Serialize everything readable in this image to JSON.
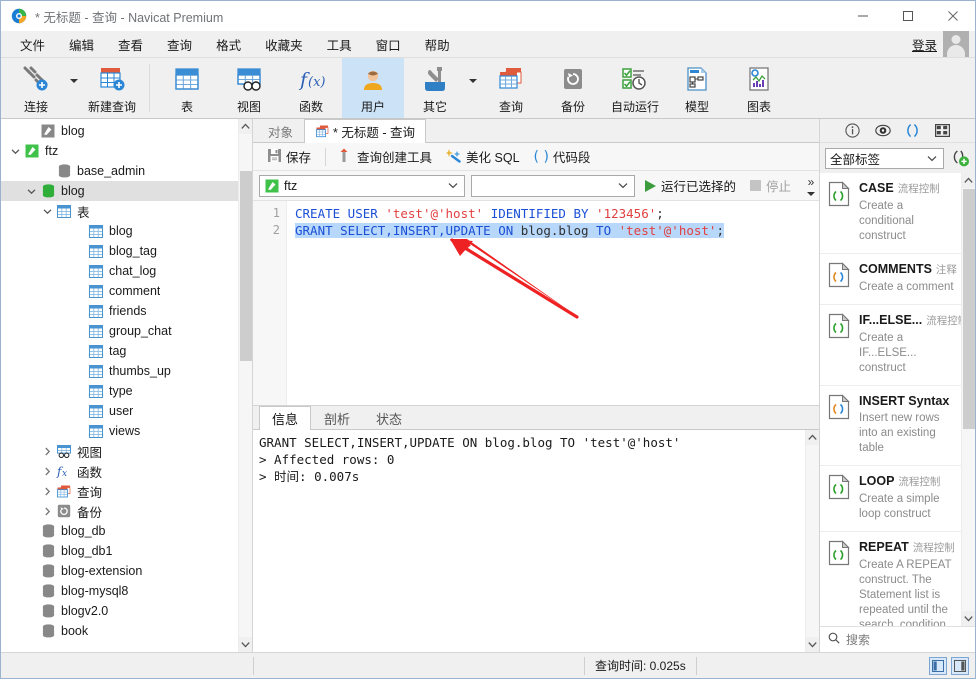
{
  "window": {
    "title_prefix": "*",
    "title": "无标题 - 查询 - Navicat Premium",
    "minimize": "–",
    "maximize": "□",
    "close": "×"
  },
  "menubar": {
    "items": [
      {
        "label": "文件"
      },
      {
        "label": "编辑"
      },
      {
        "label": "查看"
      },
      {
        "label": "查询"
      },
      {
        "label": "格式"
      },
      {
        "label": "收藏夹"
      },
      {
        "label": "工具"
      },
      {
        "label": "窗口"
      },
      {
        "label": "帮助"
      }
    ],
    "login_label": "登录"
  },
  "ribbon": {
    "items": [
      {
        "label": "连接",
        "icon": "connection-icon",
        "has_caret": true,
        "active": false
      },
      {
        "label": "新建查询",
        "icon": "new-query-icon",
        "has_caret": false,
        "active": false
      },
      {
        "label": "表",
        "icon": "table-icon",
        "active": false
      },
      {
        "label": "视图",
        "icon": "view-icon",
        "active": false
      },
      {
        "label": "函数",
        "icon": "function-icon",
        "active": false
      },
      {
        "label": "用户",
        "icon": "user-icon",
        "active": true
      },
      {
        "label": "其它",
        "icon": "other-icon",
        "has_caret": true,
        "active": false
      },
      {
        "label": "查询",
        "icon": "query-icon",
        "active": false
      },
      {
        "label": "备份",
        "icon": "backup-icon",
        "active": false
      },
      {
        "label": "自动运行",
        "icon": "automation-icon",
        "active": false
      },
      {
        "label": "模型",
        "icon": "model-icon",
        "active": false
      },
      {
        "label": "图表",
        "icon": "chart-icon",
        "active": false
      }
    ]
  },
  "sidebar": {
    "items": [
      {
        "label": "blog",
        "indent": 1,
        "icon": "connection-grey-icon",
        "twist": "none",
        "selected": false
      },
      {
        "label": "ftz",
        "indent": 0,
        "icon": "connection-green-icon",
        "twist": "open",
        "selected": false
      },
      {
        "label": "base_admin",
        "indent": 2,
        "icon": "db-grey-icon",
        "twist": "none",
        "selected": false
      },
      {
        "label": "blog",
        "indent": 1,
        "icon": "db-green-icon",
        "twist": "open",
        "selected": true
      },
      {
        "label": "表",
        "indent": 2,
        "icon": "tables-icon",
        "twist": "open",
        "selected": false
      },
      {
        "label": "blog",
        "indent": 4,
        "icon": "table-blue-icon",
        "twist": "none",
        "selected": false
      },
      {
        "label": "blog_tag",
        "indent": 4,
        "icon": "table-blue-icon",
        "twist": "none",
        "selected": false
      },
      {
        "label": "chat_log",
        "indent": 4,
        "icon": "table-blue-icon",
        "twist": "none",
        "selected": false
      },
      {
        "label": "comment",
        "indent": 4,
        "icon": "table-blue-icon",
        "twist": "none",
        "selected": false
      },
      {
        "label": "friends",
        "indent": 4,
        "icon": "table-blue-icon",
        "twist": "none",
        "selected": false
      },
      {
        "label": "group_chat",
        "indent": 4,
        "icon": "table-blue-icon",
        "twist": "none",
        "selected": false
      },
      {
        "label": "tag",
        "indent": 4,
        "icon": "table-blue-icon",
        "twist": "none",
        "selected": false
      },
      {
        "label": "thumbs_up",
        "indent": 4,
        "icon": "table-blue-icon",
        "twist": "none",
        "selected": false
      },
      {
        "label": "type",
        "indent": 4,
        "icon": "table-blue-icon",
        "twist": "none",
        "selected": false
      },
      {
        "label": "user",
        "indent": 4,
        "icon": "table-blue-icon",
        "twist": "none",
        "selected": false
      },
      {
        "label": "views",
        "indent": 4,
        "icon": "table-blue-icon",
        "twist": "none",
        "selected": false
      },
      {
        "label": "视图",
        "indent": 2,
        "icon": "views-icon",
        "twist": "closed",
        "selected": false
      },
      {
        "label": "函数",
        "indent": 2,
        "icon": "functions-icon",
        "twist": "closed",
        "selected": false
      },
      {
        "label": "查询",
        "indent": 2,
        "icon": "queries-icon",
        "twist": "closed",
        "selected": false
      },
      {
        "label": "备份",
        "indent": 2,
        "icon": "backups-icon",
        "twist": "closed",
        "selected": false
      },
      {
        "label": "blog_db",
        "indent": 1,
        "icon": "db-grey-icon",
        "twist": "none",
        "selected": false
      },
      {
        "label": "blog_db1",
        "indent": 1,
        "icon": "db-grey-icon",
        "twist": "none",
        "selected": false
      },
      {
        "label": "blog-extension",
        "indent": 1,
        "icon": "db-grey-icon",
        "twist": "none",
        "selected": false
      },
      {
        "label": "blog-mysql8",
        "indent": 1,
        "icon": "db-grey-icon",
        "twist": "none",
        "selected": false
      },
      {
        "label": "blogv2.0",
        "indent": 1,
        "icon": "db-grey-icon",
        "twist": "none",
        "selected": false
      },
      {
        "label": "book",
        "indent": 1,
        "icon": "db-grey-icon",
        "twist": "none",
        "selected": false
      }
    ]
  },
  "editor_tabs": [
    {
      "label": "对象",
      "active": false,
      "icon": "none"
    },
    {
      "label": "* 无标题 - 查询",
      "active": true,
      "icon": "query-tab-icon"
    }
  ],
  "query_toolbar": {
    "save": "保存",
    "query_builder": "查询创建工具",
    "beautify_sql": "美化 SQL",
    "code_snippet": "代码段"
  },
  "query_bar": {
    "connection_value": "ftz",
    "database_value": "",
    "run_selected": "运行已选择的",
    "stop": "停止",
    "overflow": "»"
  },
  "sql": {
    "lines": [
      {
        "number": "1",
        "selected": false,
        "tokens": [
          {
            "t": "CREATE USER ",
            "c": "kw"
          },
          {
            "t": "'test'@'host'",
            "c": "str"
          },
          {
            "t": " ",
            "c": "pl"
          },
          {
            "t": "IDENTIFIED BY ",
            "c": "kw"
          },
          {
            "t": "'123456'",
            "c": "str"
          },
          {
            "t": ";",
            "c": "pl"
          }
        ]
      },
      {
        "number": "2",
        "selected": true,
        "tokens": [
          {
            "t": "GRANT SELECT,INSERT,UPDATE ON ",
            "c": "kw"
          },
          {
            "t": "blog.blog",
            "c": "pl"
          },
          {
            "t": " ",
            "c": "pl"
          },
          {
            "t": "TO ",
            "c": "kw"
          },
          {
            "t": "'test'@'host'",
            "c": "str"
          },
          {
            "t": ";",
            "c": "pl"
          }
        ]
      }
    ]
  },
  "result_tabs": [
    {
      "label": "信息",
      "active": true
    },
    {
      "label": "剖析",
      "active": false
    },
    {
      "label": "状态",
      "active": false
    }
  ],
  "result_output": "GRANT SELECT,INSERT,UPDATE ON blog.blog TO 'test'@'host'\n> Affected rows: 0\n> 时间: 0.007s",
  "right_panel": {
    "icons": [
      {
        "name": "info-icon",
        "active": false
      },
      {
        "name": "preview-icon",
        "active": false
      },
      {
        "name": "snippet-icon",
        "active": true
      },
      {
        "name": "grid-icon",
        "active": false
      }
    ],
    "filter_value": "全部标签",
    "add_snippet": "add-snippet-icon",
    "snippets": [
      {
        "title": "CASE",
        "tag": "流程控制",
        "desc": "Create a conditional construct",
        "icon_color": "#2aa02a"
      },
      {
        "title": "COMMENTS",
        "tag": "注释",
        "desc": "Create a comment",
        "icon_color": "#e08a1e"
      },
      {
        "title": "IF...ELSE...",
        "tag": "流程控制",
        "desc": "Create a IF...ELSE... construct",
        "icon_color": "#2aa02a"
      },
      {
        "title": "INSERT Syntax",
        "tag": "",
        "desc": "Insert new rows into an existing table",
        "icon_color": "#e08a1e"
      },
      {
        "title": "LOOP",
        "tag": "流程控制",
        "desc": "Create a simple loop construct",
        "icon_color": "#2aa02a"
      },
      {
        "title": "REPEAT",
        "tag": "流程控制",
        "desc": "Create A REPEAT construct. The Statement list is repeated until the search_condition",
        "icon_color": "#2aa02a"
      }
    ],
    "search_placeholder": "搜索"
  },
  "statusbar": {
    "query_time": "查询时间: 0.025s"
  },
  "colors": {
    "accent": "#1a4fd6",
    "string": "#e04040",
    "selection": "#b8d8fb",
    "ribbon_active": "#cce3f7",
    "annotation": "#ee2222"
  }
}
